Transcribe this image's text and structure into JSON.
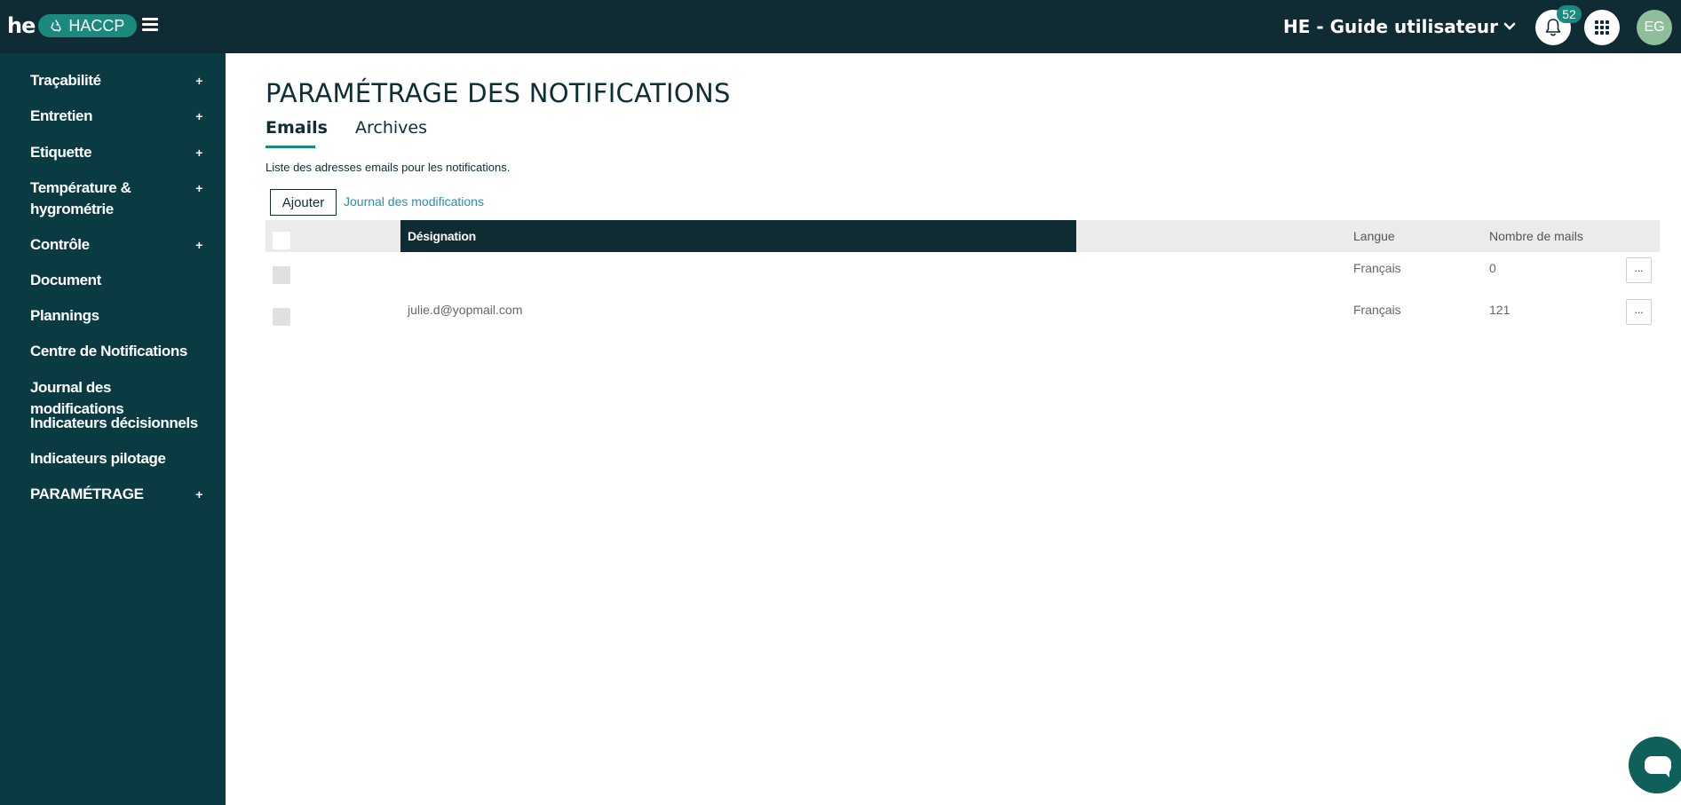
{
  "header": {
    "brand_he": "he",
    "brand_app": "HACCP",
    "site_selector": "HE - Guide utilisateur",
    "notification_count": "52",
    "avatar_initials": "EG"
  },
  "sidebar": {
    "items": [
      {
        "label": "Traçabilité",
        "expand": "+"
      },
      {
        "label": "Entretien",
        "expand": "+"
      },
      {
        "label": "Etiquette",
        "expand": "+"
      },
      {
        "label": "Température &",
        "label2": "hygrométrie",
        "expand": "+"
      },
      {
        "label": "Contrôle",
        "expand": "+"
      },
      {
        "label": "Document"
      },
      {
        "label": "Plannings"
      },
      {
        "label": "Centre de Notifications"
      },
      {
        "label": "Journal des modifications"
      },
      {
        "label": "Indicateurs décisionnels"
      },
      {
        "label": "Indicateurs pilotage"
      },
      {
        "label": "PARAMÉTRAGE",
        "expand": "+"
      }
    ]
  },
  "main": {
    "title": "PARAMÉTRAGE DES NOTIFICATIONS",
    "tabs": [
      {
        "label": "Emails",
        "active": true
      },
      {
        "label": "Archives",
        "active": false
      }
    ],
    "description": "Liste des adresses emails pour les notifications.",
    "add_button": "Ajouter",
    "journal_link": "Journal des modifications",
    "table": {
      "columns": {
        "designation": "Désignation",
        "langue": "Langue",
        "nombre": "Nombre de mails"
      },
      "rows": [
        {
          "designation": "",
          "langue": "Français",
          "nombre": "0",
          "action": "..."
        },
        {
          "designation": "julie.d@yopmail.com",
          "langue": "Français",
          "nombre": "121",
          "action": "..."
        }
      ]
    }
  },
  "colors": {
    "header_bg": "#0f2b33",
    "sidebar_bg": "#0a3a42",
    "accent": "#1b8a7e",
    "link": "#2a8fb0"
  }
}
